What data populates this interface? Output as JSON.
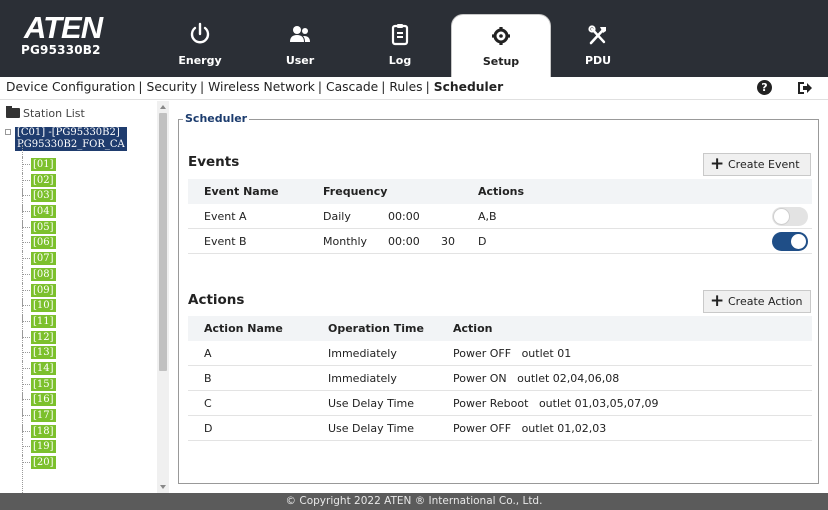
{
  "header": {
    "logo_text": "ATEN",
    "model": "PG95330B2",
    "tabs": [
      {
        "label": "Energy",
        "icon": "power-icon"
      },
      {
        "label": "User",
        "icon": "users-icon"
      },
      {
        "label": "Log",
        "icon": "clipboard-icon"
      },
      {
        "label": "Setup",
        "icon": "gear-icon",
        "active": true
      },
      {
        "label": "PDU",
        "icon": "tools-icon"
      }
    ]
  },
  "submenu": {
    "items": [
      "Device Configuration",
      "Security",
      "Wireless Network",
      "Cascade",
      "Rules",
      "Scheduler"
    ],
    "active": "Scheduler",
    "help_icon": "help-icon",
    "logout_icon": "logout-icon"
  },
  "sidebar": {
    "header": "Station List",
    "station_line1": "[C01] -[PG95330B2]",
    "station_line2": "PG95330B2_FOR_CA",
    "outlets": [
      "[01]",
      "[02]",
      "[03]",
      "[04]",
      "[05]",
      "[06]",
      "[07]",
      "[08]",
      "[09]",
      "[10]",
      "[11]",
      "[12]",
      "[13]",
      "[14]",
      "[15]",
      "[16]",
      "[17]",
      "[18]",
      "[19]",
      "[20]"
    ]
  },
  "scheduler": {
    "legend": "Scheduler",
    "events": {
      "title": "Events",
      "create_label": "Create Event",
      "columns": [
        "Event Name",
        "Frequency",
        "Actions"
      ],
      "rows": [
        {
          "name": "Event A",
          "frequency": "Daily",
          "time": "00:00",
          "day": "",
          "actions": "A,B",
          "enabled": false
        },
        {
          "name": "Event B",
          "frequency": "Monthly",
          "time": "00:00",
          "day": "30",
          "actions": "D",
          "enabled": true
        }
      ]
    },
    "actions": {
      "title": "Actions",
      "create_label": "Create Action",
      "columns": [
        "Action Name",
        "Operation Time",
        "Action"
      ],
      "rows": [
        {
          "name": "A",
          "operation_time": "Immediately",
          "action": "Power OFF",
          "outlets": "outlet 01"
        },
        {
          "name": "B",
          "operation_time": "Immediately",
          "action": "Power ON",
          "outlets": "outlet 02,04,06,08"
        },
        {
          "name": "C",
          "operation_time": "Use Delay Time",
          "action": "Power Reboot",
          "outlets": "outlet 01,03,05,07,09"
        },
        {
          "name": "D",
          "operation_time": "Use Delay Time",
          "action": "Power OFF",
          "outlets": "outlet 01,02,03"
        }
      ]
    }
  },
  "footer": {
    "copyright": "© Copyright 2022 ATEN ® International Co., Ltd."
  },
  "colors": {
    "header_bg": "#2b2f36",
    "toggle_on": "#1f4e87",
    "outlet_tag": "#7cc02c",
    "station_selected": "#1f3c6e",
    "footer_bg": "#5b5b5b"
  }
}
